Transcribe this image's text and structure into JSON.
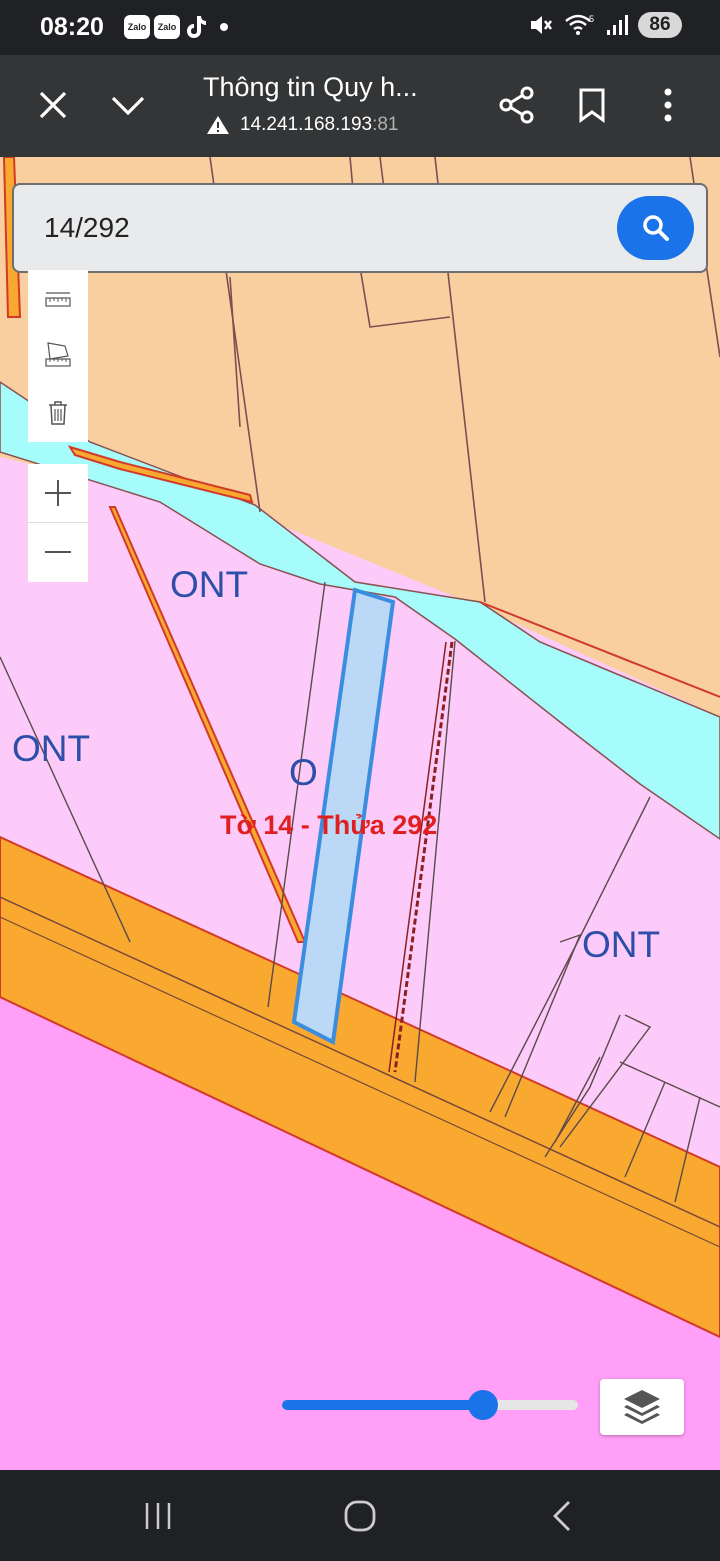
{
  "status_bar": {
    "time": "08:20",
    "notifications": [
      "Zalo",
      "Zalo",
      "tiktok-icon"
    ],
    "battery": "86",
    "network": "5"
  },
  "browser": {
    "title": "Thông tin Quy h...",
    "url_host": "14.241.168.193",
    "url_port": ":81",
    "icons": [
      "close-icon",
      "chevron-down-icon",
      "share-icon",
      "bookmark-icon",
      "more-vert-icon"
    ]
  },
  "search": {
    "value": "14/292"
  },
  "map": {
    "labels": {
      "ont_1": "ONT",
      "ont_2": "ONT",
      "ont_3": "O",
      "ont_4": "ONT",
      "parcel": "Tờ 14 - Thửa 292"
    },
    "colors": {
      "residential": "#fdcbf9",
      "agricultural": "#f9cfa0",
      "water": "#a6fbfb",
      "road": "#f9a830",
      "land_magenta": "#ff9ff7",
      "boundary": "#8b5050",
      "highlight": "#3b8de0",
      "label_red": "#e02020",
      "label_blue": "#2d4fa8"
    }
  },
  "slider": {
    "value_percent": 68
  },
  "controls": {
    "tools": [
      "measure-line-icon",
      "measure-area-icon",
      "trash-icon"
    ],
    "zoom": [
      "zoom-in-icon",
      "zoom-out-icon"
    ],
    "layers": "layers-icon"
  }
}
